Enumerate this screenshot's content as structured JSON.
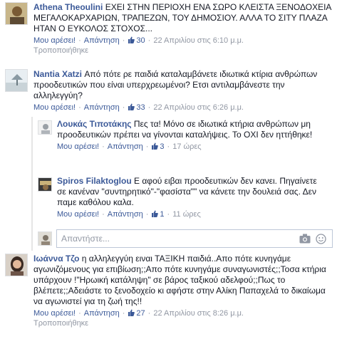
{
  "comments": [
    {
      "author": "Athena Theoulini",
      "text": "ΕΧΕΙ ΣΤΗΝ ΠΕΡΙΟΧΗ ΕΝΑ ΣΩΡΟ ΚΛΕΙΣΤΑ ΞΕΝΟΔΟΧΕΙΑ ΜΕΓΑΛΟΚΑΡΧΑΡΙΩΝ, ΤΡΑΠΕΖΩΝ, ΤΟΥ ΔΗΜΟΣΙΟΥ. ΑΛΛΑ ΤΟ ΣΙΤΥ ΠΛΑΖΑ ΗΤΑΝ Ο ΕΥΚΟΛΟΣ ΣΤΟΧΟΣ...",
      "like_label": "Μου αρέσει!",
      "reply_label": "Απάντηση",
      "likes": "30",
      "timestamp": "22 Απριλίου στις 6:10 μ.μ.",
      "edited": "Τροποποιήθηκε"
    },
    {
      "author": "Nantia Xatzi",
      "text": "Από πότε ρε παιδιά καταλαμβάνετε ιδιωτικά κτίρια ανθρώπων προοδευτικών που είναι υπερχρεωμένοι? Ετσι αντιλαμβάνεστε την αλληλεγγύη?",
      "like_label": "Μου αρέσει!",
      "reply_label": "Απάντηση",
      "likes": "33",
      "timestamp": "22 Απριλίου στις 6:26 μ.μ."
    },
    {
      "author": "Ιωάννα Τζο",
      "text": "η αλληλεγγύη ειναι ΤΑΞΙΚΗ παιδιά..Απο πότε κυνηγάμε αγωνιζόμενους για επιβίωση;;Απο πότε κυνηγάμε συναγωνιστές;;Τοσα κτήρια υπάρχουν !\"Ηρωική κατάληψη\" σε βάρος ταξικού αδελφού;;Πως το βλέπετε;;Αδειάστε το ξενοδοχείο κι αφήστε στην Αλίκη Παπαχελά το δικαίωμα να αγωνιστεί για τη ζωή της!!",
      "like_label": "Μου αρέσει!",
      "reply_label": "Απάντηση",
      "likes": "27",
      "timestamp": "22 Απριλίου στις 8:26 μ.μ.",
      "edited": "Τροποποιήθηκε"
    }
  ],
  "replies": [
    {
      "author": "Λουκάς Τιποτάκης",
      "text": "Πες τα! Μόνο σε ιδιωτικά κτήρια ανθρώπων μη προοδευτικών πρέπει να γίνονται καταλήψεις. Το ΟΧΙ δεν ηττήθηκε!",
      "like_label": "Μου αρέσει!",
      "reply_label": "Απάντηση",
      "likes": "3",
      "timestamp": "17 ώρες"
    },
    {
      "author": "Spiros Filaktoglou",
      "text": "Ε αφού ειβαι προοδευτικών δεν κανει. Πηγαίνετε σε κανέναν \"συντηρητικό\"-\"φασίστα\"\" να κάνετε την δουλειά σας. Δεν παμε καθόλου καλα.",
      "like_label": "Μου αρέσει!",
      "reply_label": "Απάντηση",
      "likes": "1",
      "timestamp": "11 ώρες"
    }
  ],
  "reply_input": {
    "placeholder": "Απαντήστε..."
  },
  "colors": {
    "link": "#3b5998",
    "meta": "#9197a3",
    "text": "#141823"
  },
  "icons": [
    "thumbs-up-icon",
    "camera-icon",
    "emoji-icon"
  ]
}
